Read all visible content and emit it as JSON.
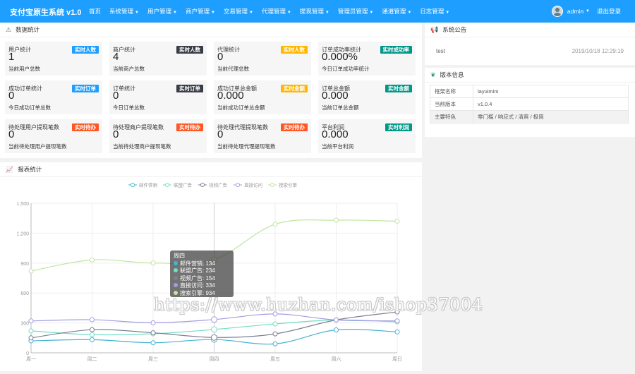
{
  "app": {
    "title": "支付宝原生系统 v1.0"
  },
  "nav": [
    {
      "label": "首页",
      "caret": false
    },
    {
      "label": "系统管理",
      "caret": true
    },
    {
      "label": "用户管理",
      "caret": true
    },
    {
      "label": "商户管理",
      "caret": true
    },
    {
      "label": "交易管理",
      "caret": true
    },
    {
      "label": "代理管理",
      "caret": true
    },
    {
      "label": "提现管理",
      "caret": true
    },
    {
      "label": "管理员管理",
      "caret": true
    },
    {
      "label": "通道管理",
      "caret": true
    },
    {
      "label": "日志管理",
      "caret": true
    }
  ],
  "user": {
    "name": "admin",
    "logout": "退出登录"
  },
  "stats_panel": {
    "title": "数据统计"
  },
  "cards": [
    {
      "title": "用户统计",
      "value": "1",
      "desc": "当前用户总数",
      "badge": "实时人数",
      "color": "#1e9fff"
    },
    {
      "title": "商户统计",
      "value": "4",
      "desc": "当前商户总数",
      "badge": "实时人数",
      "color": "#393d49"
    },
    {
      "title": "代理统计",
      "value": "0",
      "desc": "当前代理总数",
      "badge": "实时人数",
      "color": "#ffb800"
    },
    {
      "title": "订单成功率统计",
      "value": "0.000%",
      "desc": "今日订单成功率统计",
      "badge": "实时成功率",
      "color": "#009688"
    },
    {
      "title": "成功订单统计",
      "value": "0",
      "desc": "今日成功订单总数",
      "badge": "实时订单",
      "color": "#1e9fff"
    },
    {
      "title": "订单统计",
      "value": "0",
      "desc": "今日订单总数",
      "badge": "实时订单",
      "color": "#393d49"
    },
    {
      "title": "成功订单总金额",
      "value": "0.000",
      "desc": "当前成功订单总金额",
      "badge": "实时金额",
      "color": "#ffb800"
    },
    {
      "title": "订单总金额",
      "value": "0.000",
      "desc": "当前订单总金额",
      "badge": "实时金额",
      "color": "#009688"
    },
    {
      "title": "待处理用户提现笔数",
      "value": "0",
      "desc": "当前待处理用户提现笔数",
      "badge": "实时待办",
      "color": "#ff5722"
    },
    {
      "title": "待处理商户提现笔数",
      "value": "0",
      "desc": "当前待处理商户提现笔数",
      "badge": "实时待办",
      "color": "#ff5722"
    },
    {
      "title": "待处理代理提现笔数",
      "value": "0",
      "desc": "当前待处理代理提现笔数",
      "badge": "实时待办",
      "color": "#ff5722"
    },
    {
      "title": "平台利润",
      "value": "0.000",
      "desc": "当前平台利润",
      "badge": "实时利润",
      "color": "#009688"
    }
  ],
  "notice": {
    "title": "系统公告",
    "item": "test",
    "time": "2019/10/18 12:29:19"
  },
  "version": {
    "title": "版本信息",
    "rows": [
      {
        "k": "框架名称",
        "v": "layuimini"
      },
      {
        "k": "当前版本",
        "v": "v1.0.4"
      },
      {
        "k": "主要特色",
        "v": "零门槛 / 响应式 / 清爽 / 极简"
      }
    ]
  },
  "report_panel": {
    "title": "报表统计"
  },
  "tooltip": {
    "title": "周四",
    "rows": [
      {
        "label": "邮件营销: 134",
        "color": "#45b3d1"
      },
      {
        "label": "联盟广告: 234",
        "color": "#72ddc5"
      },
      {
        "label": "视频广告: 154",
        "color": "#7d7f92"
      },
      {
        "label": "直接访问: 334",
        "color": "#a29de0"
      },
      {
        "label": "搜索引擎: 934",
        "color": "#bfe5a0"
      }
    ]
  },
  "watermark": "https://www.huzhan.com/ishop37004",
  "chart_data": {
    "type": "line",
    "smooth": true,
    "categories": [
      "周一",
      "周二",
      "周三",
      "周四",
      "周五",
      "周六",
      "周日"
    ],
    "ylim": [
      0,
      1500
    ],
    "yticks": [
      "0",
      "300",
      "600",
      "900",
      "1,200",
      "1,500"
    ],
    "grid": true,
    "legend_position": "top",
    "series": [
      {
        "name": "邮件营销",
        "color": "#45b3d1",
        "values": [
          120,
          132,
          101,
          134,
          90,
          230,
          210
        ]
      },
      {
        "name": "联盟广告",
        "color": "#72ddc5",
        "values": [
          220,
          182,
          191,
          234,
          290,
          330,
          310
        ]
      },
      {
        "name": "视频广告",
        "color": "#7d7f92",
        "values": [
          150,
          232,
          201,
          154,
          190,
          330,
          410
        ]
      },
      {
        "name": "直接访问",
        "color": "#a29de0",
        "values": [
          320,
          332,
          301,
          334,
          390,
          330,
          320
        ]
      },
      {
        "name": "搜索引擎",
        "color": "#bfe5a0",
        "values": [
          820,
          932,
          901,
          934,
          1290,
          1330,
          1320
        ]
      }
    ]
  }
}
